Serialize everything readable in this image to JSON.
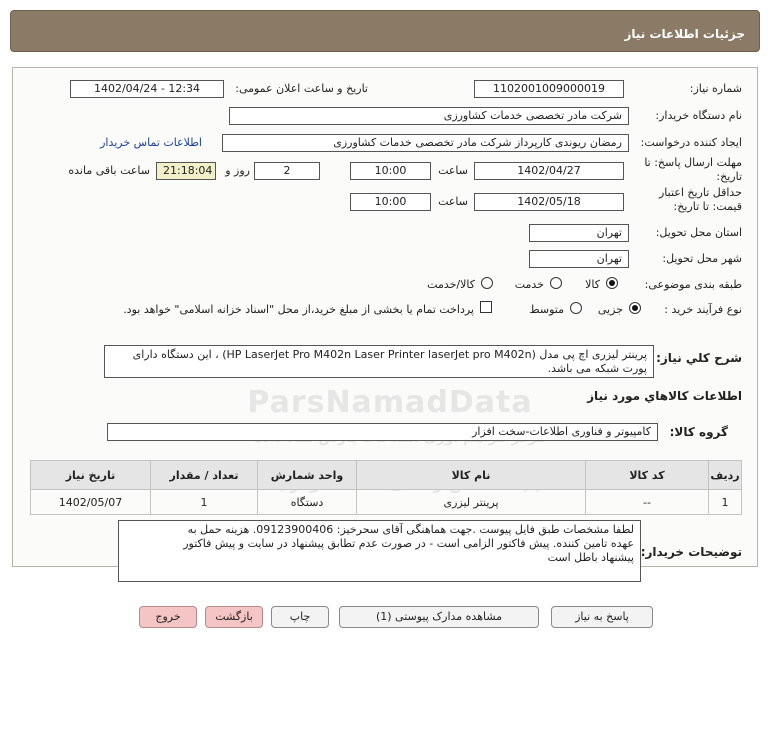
{
  "header": {
    "title": "جزئیات اطلاعات نیاز"
  },
  "form": {
    "need_number_label": "شماره نیاز:",
    "need_number": "1102001009000019",
    "announce_label": "تاریخ و ساعت اعلان عمومی:",
    "announce_value": "1402/04/24 - 12:34",
    "buyer_org_label": "نام دستگاه خریدار:",
    "buyer_org": "شرکت مادر تخصصی خدمات کشاورزی",
    "requester_label": "ایجاد کننده درخواست:",
    "requester": "رمضان ریوندی کارپرداز شرکت مادر تخصصی خدمات کشاورزی",
    "contact_link": "اطلاعات تماس خریدار",
    "deadline_label": "مهلت ارسال پاسخ: تا تاریخ:",
    "deadline_date": "1402/04/27",
    "time_label": "ساعت",
    "deadline_time": "10:00",
    "days_value": "2",
    "days_label": "روز و",
    "remaining_time": "21:18:04",
    "remaining_label": "ساعت باقی مانده",
    "validity_label": "حداقل تاریخ اعتبار قیمت: تا تاریخ:",
    "validity_date": "1402/05/18",
    "validity_time": "10:00",
    "province_label": "استان محل تحویل:",
    "province": "تهران",
    "city_label": "شهر محل تحویل:",
    "city": "تهران",
    "category_label": "طبقه بندی موضوعی:",
    "category_options": [
      "کالا",
      "خدمت",
      "کالا/خدمت"
    ],
    "category_selected": "کالا",
    "process_label": "نوع فرآیند خرید :",
    "process_options": [
      "جزیی",
      "متوسط"
    ],
    "process_selected": "جزیی",
    "payment_note": "پرداخت تمام یا بخشی از مبلغ خرید،از محل \"اسناد خزانه اسلامی\" خواهد بود."
  },
  "description": {
    "label": "شرح کلي نياز:",
    "line1": "پرینتر لیزری اچ پی مدل  (HP LaserJet Pro M402n Laser Printer  laserJet pro M402n) ، این دستگاه دارای",
    "line2": "پورت شبکه می باشد."
  },
  "goods": {
    "section_title": "اطلاعات کالاهاي مورد نياز",
    "group_label": "گروه کالا:",
    "group_value": "کامپیوتر و فناوری اطلاعات-سخت افزار",
    "columns": [
      "ردیف",
      "کد کالا",
      "نام کالا",
      "واحد شمارش",
      "تعداد / مقدار",
      "تاریخ نیاز"
    ],
    "rows": [
      {
        "row": "1",
        "code": "--",
        "name": "پرینتر لیزری",
        "unit": "دستگاه",
        "qty": "1",
        "date": "1402/05/07"
      }
    ]
  },
  "buyer_notes": {
    "label": "توضیحات خریدار:",
    "line1": "لطفا مشخصات طبق فایل پیوست .جهت هماهنگی آقای سحرخیز: 09123900406. هزینه حمل به",
    "line2": "عهده  تامین کننده. پیش فاکتور الزامی است - در صورت عدم تطابق پیشنهاد در سایت و پیش فاکتور",
    "line3": "پیشنهاد باطل است"
  },
  "buttons": {
    "reply": "پاسخ به نیاز",
    "attachments": "مشاهده مدارک پیوستی (1)",
    "print": "چاپ",
    "back": "بازگشت",
    "exit": "خروج"
  },
  "watermark": {
    "brand": "ParsNamadData",
    "line1": "مرکز فراهم آوری اطلاعات پارس نماد داده",
    "line2": "پایگاه اطلاع رسانی مناقصه ومزایده"
  }
}
